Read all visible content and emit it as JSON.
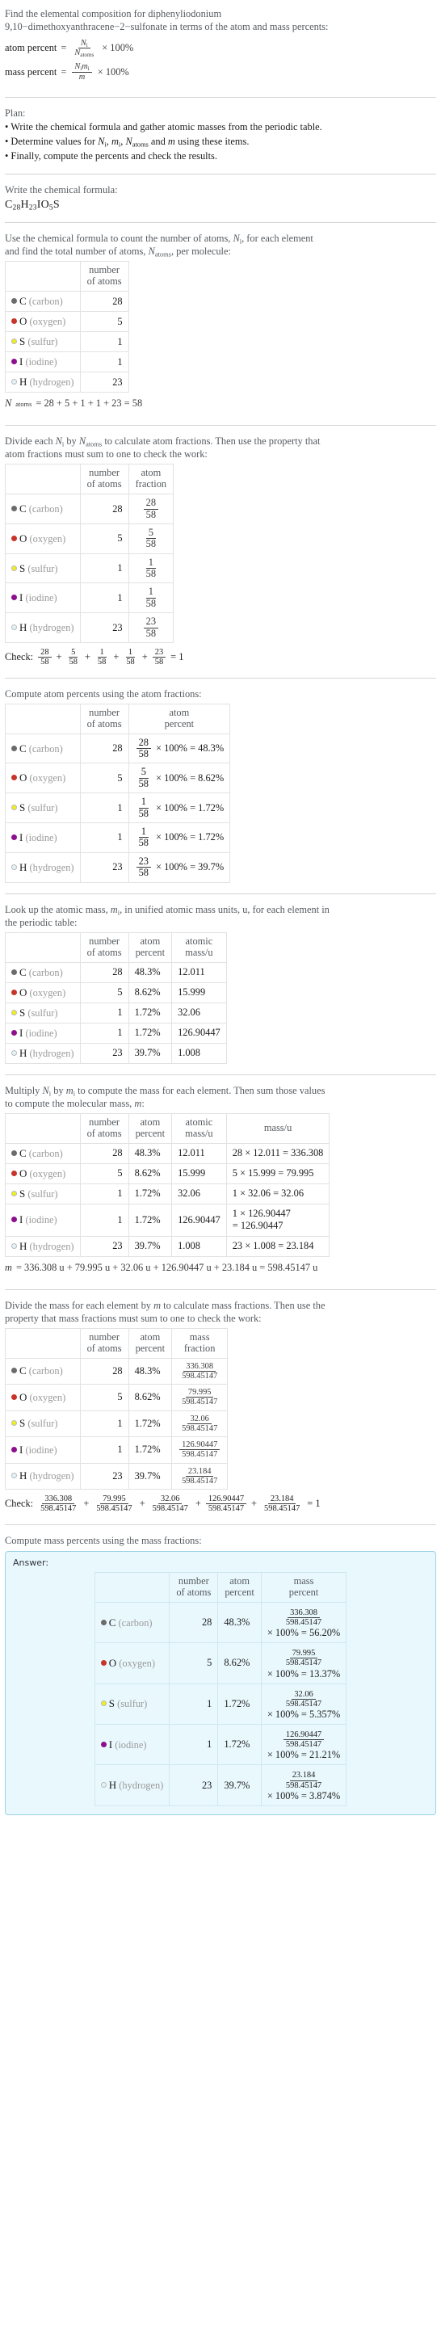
{
  "question": {
    "line1": "Find the elemental composition for diphenyliodonium",
    "line2": "9,10−dimethoxyanthracene−2−sulfonate in terms of the atom and mass percents:",
    "atom_percent_label": "atom percent",
    "mass_percent_label": "mass percent",
    "equals": "=",
    "times100": "× 100%",
    "atom_num": "N",
    "atom_num_sub": "i",
    "atom_den": "N",
    "atom_den_sub": "atoms",
    "mass_num": "N",
    "mass_num_sub": "i",
    "mass_num2": "m",
    "mass_num2_sub": "i",
    "mass_den": "m"
  },
  "plan": {
    "heading": "Plan:",
    "items": [
      "• Write the chemical formula and gather atomic masses from the periodic table.",
      "• Finally, compute the percents and check the results."
    ],
    "item2_pre": "• Determine values for ",
    "item2_mid": ", ",
    "item2_post": " and ",
    "item2_end": " using these items."
  },
  "formula_section": {
    "prompt": "Write the chemical formula:",
    "parts": [
      {
        "sym": "C",
        "sub": "28"
      },
      {
        "sym": "H",
        "sub": "23"
      },
      {
        "sym": "I",
        "sub": ""
      },
      {
        "sym": "O",
        "sub": "5"
      },
      {
        "sym": "S",
        "sub": ""
      }
    ]
  },
  "count_section": {
    "prompt_a": "Use the chemical formula to count the number of atoms, ",
    "prompt_b": ", for each element",
    "prompt_c": "and find the total number of atoms, ",
    "prompt_d": ", per molecule:",
    "header_atoms": "number\nof atoms",
    "total_line": "= 28 + 5 + 1 + 1 + 23 = 58"
  },
  "fraction_section": {
    "prompt_a": "Divide each ",
    "prompt_b": " by ",
    "prompt_c": " to calculate atom fractions. Then use the property that",
    "prompt_d": "atom fractions must sum to one to check the work:",
    "header_fraction": "atom\nfraction",
    "check_label": "Check:",
    "check_result": "= 1"
  },
  "atom_percent_section": {
    "prompt": "Compute atom percents using the atom fractions:",
    "header_percent": "atom\npercent"
  },
  "atomic_mass_section": {
    "prompt_a": "Look up the atomic mass, ",
    "prompt_b": ", in unified atomic mass units, u, for each element in",
    "prompt_c": "the periodic table:",
    "header_mass": "atomic\nmass/u"
  },
  "mass_section": {
    "prompt_a": "Multiply ",
    "prompt_b": " by ",
    "prompt_c": " to compute the mass for each element. Then sum those values",
    "prompt_d": "to compute the molecular mass, ",
    "prompt_e": ":",
    "header_massu": "mass/u",
    "total_line": "= 336.308 u + 79.995 u + 32.06 u + 126.90447 u + 23.184 u = 598.45147 u"
  },
  "mass_fraction_section": {
    "prompt_a": "Divide the mass for each element by ",
    "prompt_b": " to calculate mass fractions. Then use the",
    "prompt_c": "property that mass fractions must sum to one to check the work:",
    "header_fraction": "mass\nfraction",
    "check_label": "Check:",
    "check_result": "= 1"
  },
  "mass_percent_section": {
    "prompt": "Compute mass percents using the mass fractions:",
    "answer_label": "Answer:",
    "header_percent": "mass\npercent"
  },
  "totals": {
    "n_atoms": "58",
    "molecular_mass": "598.45147"
  },
  "elements": [
    {
      "symbol": "C",
      "name": "(carbon)",
      "color": "#6b6b6b",
      "count": "28",
      "atom_fraction_num": "28",
      "atom_fraction_den": "58",
      "atom_percent": "48.3%",
      "atomic_mass": "12.011",
      "mass_expr": "28 × 12.011 = 336.308",
      "mass_expr_l1": "28 × 12.011 = 336.308",
      "mass_expr_l2": "",
      "mass_num": "336.308",
      "mass_den": "598.45147",
      "mass_percent": "56.20%"
    },
    {
      "symbol": "O",
      "name": "(oxygen)",
      "color": "#c8342a",
      "count": "5",
      "atom_fraction_num": "5",
      "atom_fraction_den": "58",
      "atom_percent": "8.62%",
      "atomic_mass": "15.999",
      "mass_expr": "5 × 15.999 = 79.995",
      "mass_expr_l1": "5 × 15.999 = 79.995",
      "mass_expr_l2": "",
      "mass_num": "79.995",
      "mass_den": "598.45147",
      "mass_percent": "13.37%"
    },
    {
      "symbol": "S",
      "name": "(sulfur)",
      "color": "#efef20",
      "count": "1",
      "atom_fraction_num": "1",
      "atom_fraction_den": "58",
      "atom_percent": "1.72%",
      "atomic_mass": "32.06",
      "mass_expr": "1 × 32.06 = 32.06",
      "mass_expr_l1": "1 × 32.06 = 32.06",
      "mass_expr_l2": "",
      "mass_num": "32.06",
      "mass_den": "598.45147",
      "mass_percent": "5.357%"
    },
    {
      "symbol": "I",
      "name": "(iodine)",
      "color": "#8e0f8e",
      "count": "1",
      "atom_fraction_num": "1",
      "atom_fraction_den": "58",
      "atom_percent": "1.72%",
      "atomic_mass": "126.90447",
      "mass_expr": "1 × 126.90447 = 126.90447",
      "mass_expr_l1": "1 × 126.90447",
      "mass_expr_l2": "= 126.90447",
      "mass_num": "126.90447",
      "mass_den": "598.45147",
      "mass_percent": "21.21%"
    },
    {
      "symbol": "H",
      "name": "(hydrogen)",
      "color": "#e3f4f8",
      "count": "23",
      "atom_fraction_num": "23",
      "atom_fraction_den": "58",
      "atom_percent": "39.7%",
      "atomic_mass": "1.008",
      "mass_expr": "23 × 1.008 = 23.184",
      "mass_expr_l1": "23 × 1.008 = 23.184",
      "mass_expr_l2": "",
      "mass_num": "23.184",
      "mass_den": "598.45147",
      "mass_percent": "3.874%"
    }
  ],
  "symbols": {
    "N": "N",
    "m": "m",
    "i": "i",
    "atoms": "atoms",
    "times": "×",
    "pct100": "100%",
    "eq": "=",
    "plus": "+",
    "N_atoms_label": "N"
  }
}
